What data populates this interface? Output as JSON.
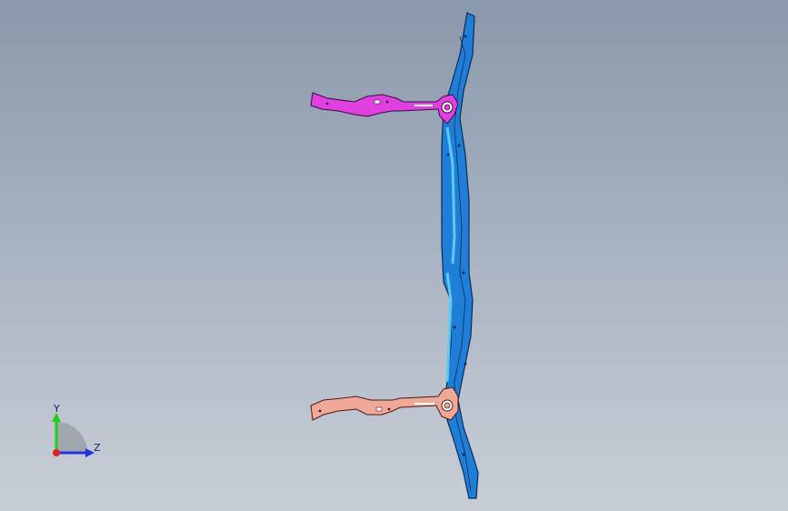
{
  "viewport": {
    "background_top": "#8a98ab",
    "background_bottom": "#c8ced6"
  },
  "model": {
    "parts": [
      {
        "name": "main-beam",
        "color": "#1f7fd8"
      },
      {
        "name": "upper-bracket",
        "color": "#e040e0"
      },
      {
        "name": "lower-bracket",
        "color": "#f0a898"
      }
    ]
  },
  "triad": {
    "y_label": "Y",
    "z_label": "Z",
    "y_color": "#22cc22",
    "z_color": "#2233dd",
    "x_color": "#dd2222"
  }
}
